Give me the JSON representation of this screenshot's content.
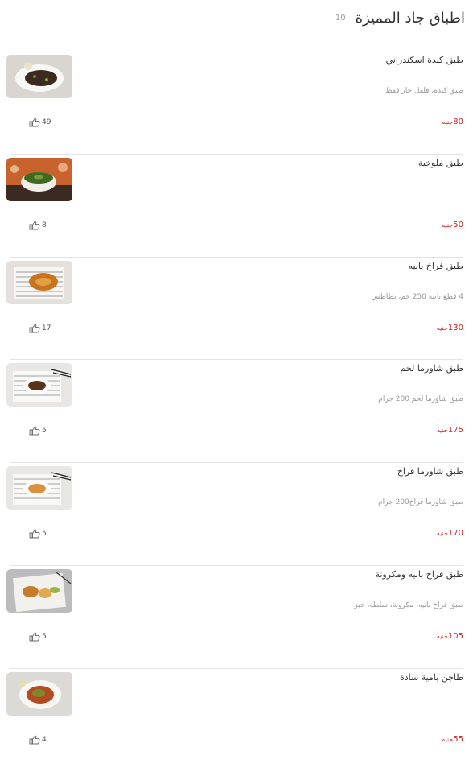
{
  "header": {
    "title": "اطباق جاد المميزة",
    "count": "10"
  },
  "items": [
    {
      "name": "طبق كبدة اسكندراني",
      "description": "طبق كبدة، فلفل حار فقط",
      "price": "80",
      "currency": "جنيه",
      "likes": "49",
      "image": "liver-plate"
    },
    {
      "name": "طبق ملوخية",
      "description": "",
      "price": "50",
      "currency": "جنيه",
      "likes": "8",
      "image": "molokhia-bowl"
    },
    {
      "name": "طبق فراخ بانيه",
      "description": "4 قطع بانيه 250 جم، بطاطس",
      "price": "130",
      "currency": "جنيه",
      "likes": "17",
      "image": "pane-plate"
    },
    {
      "name": "طبق شاورما لحم",
      "description": "طبق شاورما لحم 200 جرام",
      "price": "175",
      "currency": "جنيه",
      "likes": "5",
      "image": "meat-shawarma-plate"
    },
    {
      "name": "طبق شاورما فراخ",
      "description": "طبق شاورما فراخ200 جرام",
      "price": "170",
      "currency": "جنيه",
      "likes": "5",
      "image": "chicken-shawarma-plate"
    },
    {
      "name": "طبق فراخ بانيه ومكرونة",
      "description": "طبق فراخ بانيه، مكرونة، سلطة، خبز",
      "price": "105",
      "currency": "جنيه",
      "likes": "5",
      "image": "pane-pasta-plate"
    },
    {
      "name": "طاجن بامية سادة",
      "description": "",
      "price": "55",
      "currency": "جنيه",
      "likes": "4",
      "image": "okra-tagine"
    }
  ],
  "colors": {
    "price": "#cc2222",
    "text": "#333333",
    "muted": "#9a9a9a",
    "separator": "#e3e3e3"
  },
  "icons": {
    "likes": "thumbs-up-icon"
  }
}
